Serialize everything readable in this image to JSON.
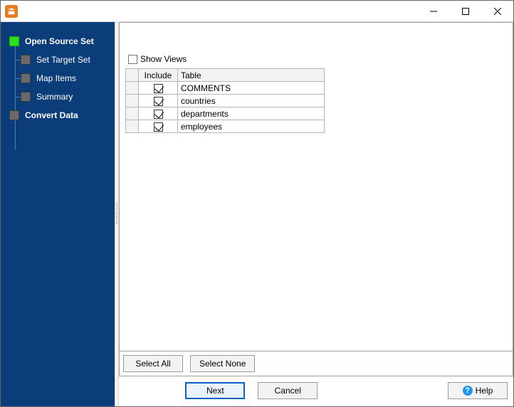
{
  "titlebar": {
    "title": ""
  },
  "sidebar": {
    "steps": [
      {
        "label": "Open Source Set",
        "active": true,
        "child": false
      },
      {
        "label": "Set Target Set",
        "active": false,
        "child": true
      },
      {
        "label": "Map Items",
        "active": false,
        "child": true
      },
      {
        "label": "Summary",
        "active": false,
        "child": true
      },
      {
        "label": "Convert Data",
        "active": false,
        "child": false
      }
    ]
  },
  "content": {
    "show_views_label": "Show Views",
    "show_views_checked": false,
    "columns": {
      "include": "Include",
      "table": "Table"
    },
    "rows": [
      {
        "include": true,
        "table": "COMMENTS"
      },
      {
        "include": true,
        "table": "countries"
      },
      {
        "include": true,
        "table": "departments"
      },
      {
        "include": true,
        "table": "employees"
      }
    ]
  },
  "buttons": {
    "select_all": "Select All",
    "select_none": "Select None",
    "next": "Next",
    "cancel": "Cancel",
    "help": "Help"
  }
}
